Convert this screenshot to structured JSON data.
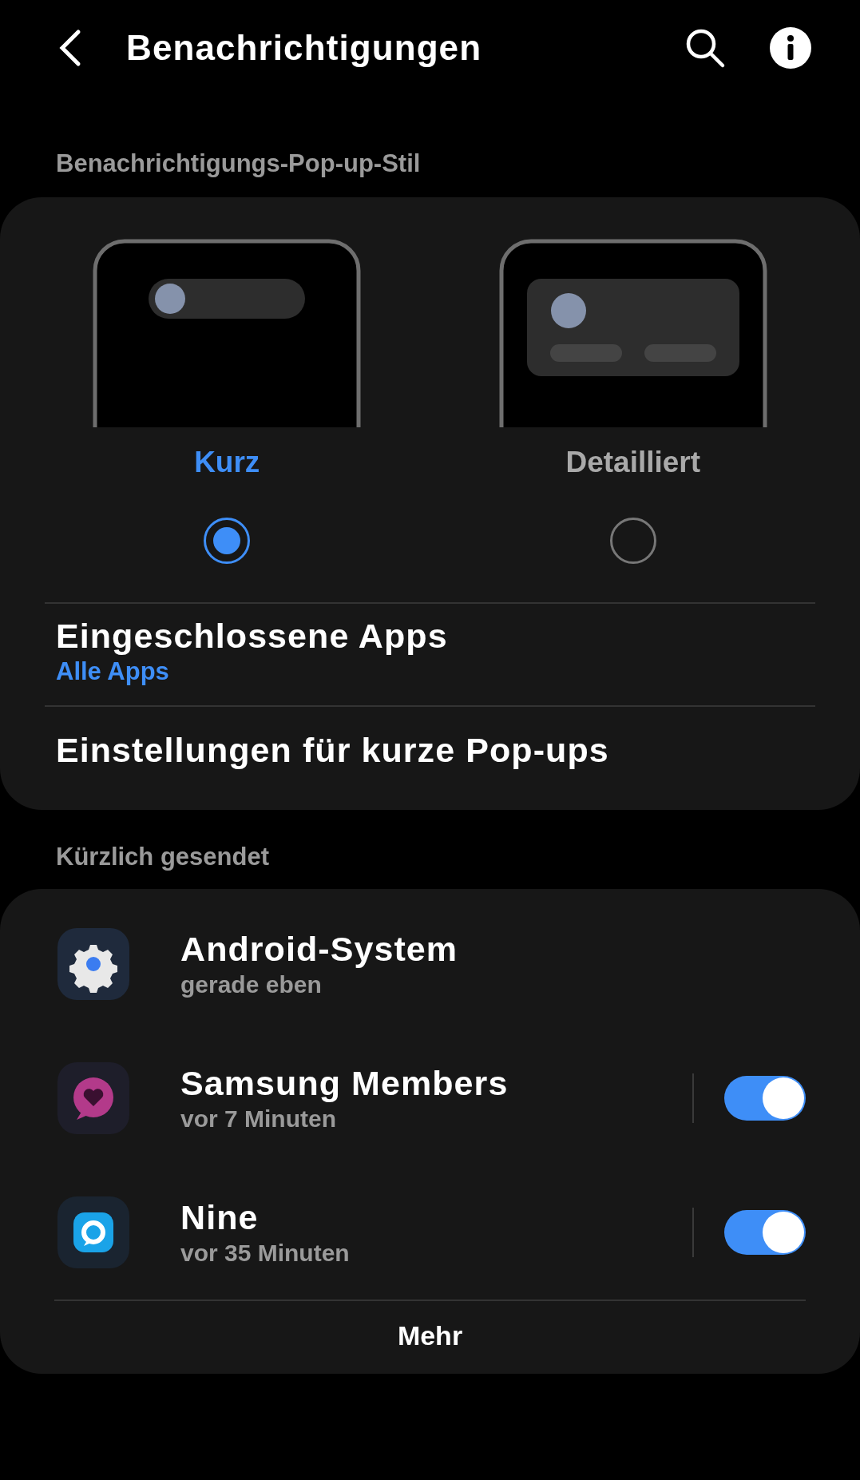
{
  "header": {
    "title": "Benachrichtigungen"
  },
  "popup_style": {
    "label": "Benachrichtigungs-Pop-up-Stil",
    "options": [
      {
        "kind": "brief",
        "label": "Kurz",
        "selected": true
      },
      {
        "kind": "detailed",
        "label": "Detailliert",
        "selected": false
      }
    ],
    "rows": [
      {
        "title": "Eingeschlossene Apps",
        "subtitle": "Alle Apps"
      },
      {
        "title": "Einstellungen für kurze Pop-ups"
      }
    ]
  },
  "recent": {
    "label": "Kürzlich gesendet",
    "apps": [
      {
        "kind": "plain",
        "name": "Android-System",
        "time": "gerade eben"
      },
      {
        "kind": "toggle",
        "name": "Samsung Members",
        "time": "vor 7 Minuten",
        "on": true
      },
      {
        "kind": "toggle",
        "name": "Nine",
        "time": "vor 35 Minuten",
        "on": true
      }
    ],
    "more": "Mehr"
  }
}
